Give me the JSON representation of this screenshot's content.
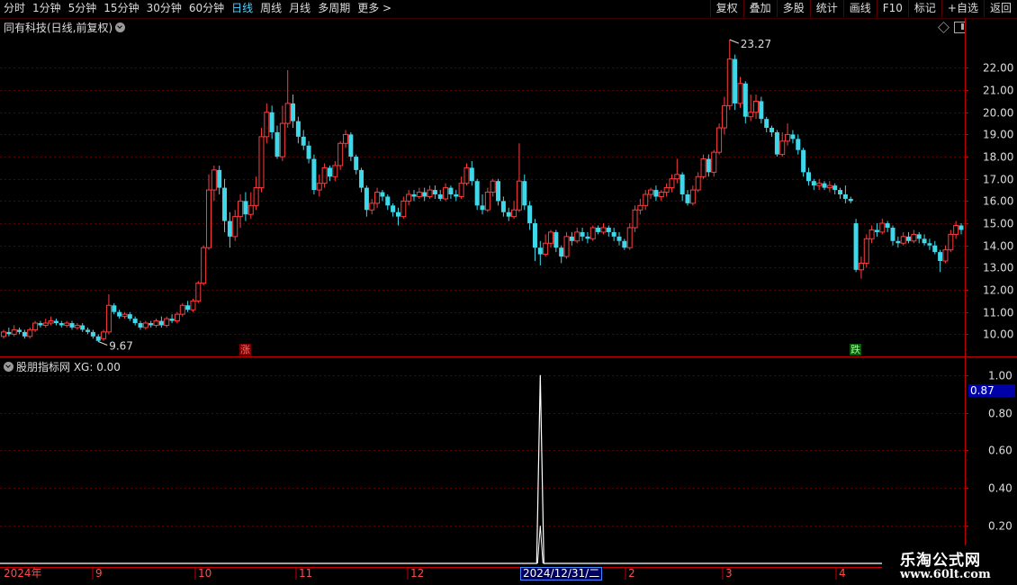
{
  "toolbar": {
    "left_items": [
      "分时",
      "1分钟",
      "5分钟",
      "15分钟",
      "30分钟",
      "60分钟",
      "日线",
      "周线",
      "月线",
      "多周期",
      "更多 >"
    ],
    "active": "日线",
    "right_buttons": [
      "复权",
      "叠加",
      "多股",
      "统计",
      "画线",
      "F10",
      "标记",
      "+自选",
      "返回"
    ]
  },
  "main_title": "同有科技(日线,前复权)",
  "indicator_title": "股朋指标网 XG: 0.00",
  "markers": {
    "rise": "涨",
    "fall": "跌"
  },
  "price_annotations": {
    "high": "23.27",
    "low": "9.67"
  },
  "date_labels": [
    "2024年",
    "9",
    "10",
    "11",
    "12",
    "2",
    "3",
    "4"
  ],
  "date_highlight": "2024/12/31/二",
  "indicator_current": "0.87",
  "watermark": {
    "line1": "乐淘公式网",
    "line2": "www.60lt.com"
  },
  "colors": {
    "up": "#ff3c3c",
    "down": "#3fd8ea",
    "background": "#000000",
    "grid": "#5a0000",
    "axis": "#c00000"
  },
  "chart_data": [
    {
      "type": "candlestick",
      "title": "同有科技(日线,前复权)",
      "y_ticks": [
        "10.00",
        "11.00",
        "12.00",
        "13.00",
        "14.00",
        "15.00",
        "16.00",
        "17.00",
        "18.00",
        "19.00",
        "20.00",
        "21.00",
        "22.00"
      ],
      "ylim": [
        9.0,
        23.6
      ],
      "high": 23.27,
      "low": 9.67,
      "candles": [
        [
          9.9,
          10.1,
          9.8,
          10.2
        ],
        [
          10.1,
          10.0,
          9.9,
          10.3
        ],
        [
          10.0,
          10.2,
          9.9,
          10.4
        ],
        [
          10.2,
          10.1,
          10.0,
          10.3
        ],
        [
          10.1,
          9.9,
          9.8,
          10.2
        ],
        [
          9.9,
          10.2,
          9.8,
          10.3
        ],
        [
          10.2,
          10.5,
          10.1,
          10.6
        ],
        [
          10.5,
          10.4,
          10.3,
          10.6
        ],
        [
          10.4,
          10.5,
          10.3,
          10.7
        ],
        [
          10.5,
          10.6,
          10.4,
          10.8
        ],
        [
          10.6,
          10.5,
          10.4,
          10.7
        ],
        [
          10.5,
          10.4,
          10.3,
          10.6
        ],
        [
          10.4,
          10.5,
          10.3,
          10.6
        ],
        [
          10.5,
          10.3,
          10.2,
          10.6
        ],
        [
          10.3,
          10.4,
          10.2,
          10.5
        ],
        [
          10.4,
          10.2,
          10.1,
          10.5
        ],
        [
          10.2,
          10.1,
          10.0,
          10.3
        ],
        [
          10.1,
          9.9,
          9.8,
          10.2
        ],
        [
          9.9,
          9.7,
          9.67,
          10.0
        ],
        [
          9.8,
          10.1,
          9.7,
          10.2
        ],
        [
          10.1,
          11.3,
          10.0,
          11.8
        ],
        [
          11.3,
          11.0,
          10.9,
          11.4
        ],
        [
          11.0,
          10.8,
          10.7,
          11.1
        ],
        [
          10.8,
          10.9,
          10.7,
          11.0
        ],
        [
          10.9,
          10.7,
          10.6,
          11.0
        ],
        [
          10.7,
          10.5,
          10.4,
          10.8
        ],
        [
          10.5,
          10.3,
          10.2,
          10.6
        ],
        [
          10.3,
          10.5,
          10.2,
          10.6
        ],
        [
          10.5,
          10.4,
          10.3,
          10.6
        ],
        [
          10.4,
          10.6,
          10.3,
          10.7
        ],
        [
          10.6,
          10.4,
          10.3,
          10.8
        ],
        [
          10.4,
          10.7,
          10.3,
          10.8
        ],
        [
          10.7,
          10.6,
          10.5,
          10.9
        ],
        [
          10.6,
          10.9,
          10.5,
          11.0
        ],
        [
          10.9,
          11.3,
          10.8,
          11.4
        ],
        [
          11.3,
          11.1,
          11.0,
          11.5
        ],
        [
          11.1,
          11.5,
          11.0,
          11.6
        ],
        [
          11.5,
          12.3,
          11.4,
          12.4
        ],
        [
          12.3,
          13.9,
          12.2,
          14.0
        ],
        [
          13.9,
          16.5,
          13.8,
          17.2
        ],
        [
          16.5,
          17.4,
          16.0,
          17.6
        ],
        [
          17.4,
          16.6,
          16.3,
          17.6
        ],
        [
          16.6,
          15.1,
          14.6,
          17.0
        ],
        [
          15.1,
          14.4,
          13.9,
          15.5
        ],
        [
          14.4,
          15.3,
          14.2,
          15.6
        ],
        [
          15.3,
          16.0,
          14.8,
          16.3
        ],
        [
          16.0,
          15.4,
          15.1,
          16.4
        ],
        [
          15.4,
          15.8,
          15.2,
          16.4
        ],
        [
          15.8,
          16.6,
          15.6,
          17.1
        ],
        [
          16.6,
          18.9,
          16.4,
          19.3
        ],
        [
          18.9,
          20.0,
          18.6,
          20.4
        ],
        [
          20.0,
          19.1,
          18.8,
          20.3
        ],
        [
          19.1,
          18.0,
          17.9,
          19.4
        ],
        [
          18.0,
          19.5,
          17.8,
          20.3
        ],
        [
          19.5,
          20.4,
          19.3,
          21.9
        ],
        [
          20.4,
          19.6,
          19.3,
          20.8
        ],
        [
          19.6,
          18.9,
          18.6,
          19.8
        ],
        [
          18.9,
          18.5,
          18.3,
          19.2
        ],
        [
          18.5,
          17.9,
          17.7,
          18.7
        ],
        [
          17.9,
          16.5,
          16.3,
          18.1
        ],
        [
          16.5,
          16.8,
          16.2,
          17.2
        ],
        [
          16.8,
          17.5,
          16.6,
          17.7
        ],
        [
          17.5,
          17.1,
          16.9,
          17.6
        ],
        [
          17.1,
          17.6,
          16.9,
          17.8
        ],
        [
          17.6,
          18.6,
          17.4,
          18.7
        ],
        [
          18.6,
          19.0,
          18.4,
          19.2
        ],
        [
          19.0,
          18.0,
          17.8,
          19.1
        ],
        [
          18.0,
          17.4,
          17.2,
          18.1
        ],
        [
          17.4,
          16.6,
          16.4,
          17.5
        ],
        [
          16.6,
          15.6,
          15.3,
          16.7
        ],
        [
          15.6,
          15.9,
          15.4,
          16.1
        ],
        [
          15.9,
          16.4,
          15.7,
          16.6
        ],
        [
          16.4,
          16.2,
          16.0,
          16.5
        ],
        [
          16.2,
          15.8,
          15.6,
          16.3
        ],
        [
          15.8,
          15.5,
          15.3,
          15.9
        ],
        [
          15.5,
          15.3,
          14.9,
          15.7
        ],
        [
          15.3,
          16.0,
          15.2,
          16.2
        ],
        [
          16.0,
          16.3,
          15.8,
          16.5
        ],
        [
          16.3,
          16.2,
          16.0,
          16.5
        ],
        [
          16.2,
          16.4,
          16.1,
          16.6
        ],
        [
          16.4,
          16.2,
          16.0,
          16.6
        ],
        [
          16.2,
          16.5,
          16.1,
          16.7
        ],
        [
          16.5,
          16.3,
          16.1,
          16.7
        ],
        [
          16.3,
          16.1,
          16.0,
          16.5
        ],
        [
          16.1,
          16.6,
          16.0,
          16.8
        ],
        [
          16.6,
          16.3,
          16.1,
          16.7
        ],
        [
          16.3,
          16.2,
          16.0,
          16.5
        ],
        [
          16.2,
          16.8,
          16.1,
          17.1
        ],
        [
          16.8,
          17.5,
          16.7,
          17.7
        ],
        [
          17.5,
          16.9,
          16.7,
          17.8
        ],
        [
          16.9,
          15.8,
          15.6,
          17.0
        ],
        [
          15.8,
          15.6,
          15.4,
          16.3
        ],
        [
          15.6,
          16.4,
          15.5,
          16.6
        ],
        [
          16.4,
          16.9,
          16.2,
          17.0
        ],
        [
          16.9,
          16.0,
          15.8,
          17.0
        ],
        [
          16.0,
          15.5,
          15.3,
          16.2
        ],
        [
          15.5,
          15.3,
          15.1,
          15.7
        ],
        [
          15.3,
          15.6,
          15.2,
          16.0
        ],
        [
          15.6,
          16.9,
          15.5,
          18.6
        ],
        [
          16.9,
          15.8,
          15.6,
          17.2
        ],
        [
          15.8,
          15.0,
          14.7,
          16.0
        ],
        [
          15.0,
          13.9,
          13.3,
          15.2
        ],
        [
          13.9,
          13.6,
          13.1,
          14.2
        ],
        [
          13.6,
          14.1,
          13.5,
          14.5
        ],
        [
          14.1,
          14.6,
          13.9,
          14.7
        ],
        [
          14.6,
          13.9,
          13.7,
          14.7
        ],
        [
          13.9,
          13.5,
          13.2,
          14.0
        ],
        [
          13.5,
          14.4,
          13.4,
          14.6
        ],
        [
          14.4,
          14.2,
          14.0,
          14.6
        ],
        [
          14.2,
          14.6,
          14.1,
          14.8
        ],
        [
          14.6,
          14.4,
          14.2,
          14.8
        ],
        [
          14.4,
          14.3,
          14.1,
          14.6
        ],
        [
          14.3,
          14.8,
          14.2,
          14.9
        ],
        [
          14.8,
          14.6,
          14.5,
          14.9
        ],
        [
          14.6,
          14.8,
          14.5,
          15.0
        ],
        [
          14.8,
          14.6,
          14.4,
          14.9
        ],
        [
          14.6,
          14.4,
          14.2,
          14.8
        ],
        [
          14.4,
          14.2,
          14.0,
          14.6
        ],
        [
          14.2,
          13.9,
          13.8,
          14.3
        ],
        [
          13.9,
          14.8,
          13.8,
          15.0
        ],
        [
          14.8,
          15.6,
          14.6,
          15.8
        ],
        [
          15.6,
          15.8,
          15.4,
          16.1
        ],
        [
          15.8,
          16.3,
          15.6,
          16.5
        ],
        [
          16.3,
          16.5,
          16.1,
          16.6
        ],
        [
          16.5,
          16.2,
          16.0,
          16.7
        ],
        [
          16.2,
          16.4,
          16.0,
          16.5
        ],
        [
          16.4,
          16.6,
          16.2,
          16.8
        ],
        [
          16.6,
          17.0,
          16.4,
          17.2
        ],
        [
          17.0,
          17.2,
          16.8,
          17.9
        ],
        [
          17.2,
          16.3,
          16.0,
          17.3
        ],
        [
          16.3,
          15.9,
          15.8,
          16.5
        ],
        [
          15.9,
          16.5,
          15.8,
          16.7
        ],
        [
          16.5,
          17.1,
          16.4,
          17.3
        ],
        [
          17.1,
          17.9,
          17.0,
          18.1
        ],
        [
          17.9,
          17.3,
          17.1,
          18.1
        ],
        [
          17.3,
          18.2,
          17.1,
          18.3
        ],
        [
          18.2,
          19.3,
          18.1,
          19.5
        ],
        [
          19.3,
          20.3,
          19.0,
          20.7
        ],
        [
          20.3,
          22.4,
          20.1,
          23.27
        ],
        [
          22.4,
          20.4,
          20.1,
          22.6
        ],
        [
          20.4,
          21.3,
          20.2,
          21.6
        ],
        [
          21.3,
          19.8,
          19.5,
          21.4
        ],
        [
          19.8,
          20.0,
          19.6,
          20.8
        ],
        [
          20.0,
          20.5,
          19.7,
          20.8
        ],
        [
          20.5,
          19.7,
          19.5,
          20.7
        ],
        [
          19.7,
          19.3,
          19.1,
          19.8
        ],
        [
          19.3,
          19.1,
          18.9,
          19.4
        ],
        [
          19.1,
          18.1,
          18.0,
          19.2
        ],
        [
          18.1,
          18.7,
          18.0,
          19.1
        ],
        [
          18.7,
          19.0,
          18.5,
          19.5
        ],
        [
          19.0,
          18.8,
          18.6,
          19.2
        ],
        [
          18.8,
          18.3,
          18.1,
          19.0
        ],
        [
          18.3,
          17.3,
          17.1,
          18.4
        ],
        [
          17.3,
          16.9,
          16.7,
          17.5
        ],
        [
          16.9,
          16.7,
          16.5,
          17.0
        ],
        [
          16.7,
          16.8,
          16.5,
          17.0
        ],
        [
          16.8,
          16.6,
          16.5,
          16.9
        ],
        [
          16.6,
          16.7,
          16.4,
          16.9
        ],
        [
          16.7,
          16.5,
          16.3,
          16.8
        ],
        [
          16.5,
          16.3,
          16.1,
          16.6
        ],
        [
          16.3,
          16.1,
          15.9,
          16.7
        ],
        [
          16.1,
          16.0,
          15.9,
          16.2
        ],
        [
          15.0,
          12.9,
          12.8,
          15.2
        ],
        [
          12.9,
          13.2,
          12.5,
          13.5
        ],
        [
          13.2,
          14.3,
          13.0,
          14.5
        ],
        [
          14.3,
          14.7,
          14.1,
          14.9
        ],
        [
          14.7,
          14.6,
          14.4,
          15.0
        ],
        [
          14.6,
          15.0,
          14.5,
          15.2
        ],
        [
          15.0,
          14.8,
          14.6,
          15.1
        ],
        [
          14.8,
          14.2,
          14.0,
          14.9
        ],
        [
          14.2,
          14.1,
          13.9,
          14.4
        ],
        [
          14.1,
          14.4,
          14.0,
          14.6
        ],
        [
          14.4,
          14.2,
          14.1,
          14.6
        ],
        [
          14.2,
          14.5,
          14.1,
          14.7
        ],
        [
          14.5,
          14.3,
          14.1,
          14.6
        ],
        [
          14.3,
          14.1,
          14.0,
          14.5
        ],
        [
          14.1,
          14.0,
          13.8,
          14.3
        ],
        [
          14.0,
          13.7,
          13.6,
          14.2
        ],
        [
          13.7,
          13.3,
          12.8,
          13.8
        ],
        [
          13.3,
          13.8,
          13.2,
          14.0
        ],
        [
          13.8,
          14.5,
          13.7,
          14.7
        ],
        [
          14.5,
          14.9,
          14.3,
          15.1
        ],
        [
          14.9,
          14.7,
          14.5,
          15.0
        ]
      ]
    },
    {
      "type": "line",
      "title": "股朋指标网 XG: 0.00",
      "y_ticks": [
        "0.20",
        "0.40",
        "0.60",
        "0.80",
        "1.00"
      ],
      "ylim": [
        0.0,
        1.08
      ],
      "x_pulse_index": 102,
      "value_at_pulse": 1.0
    }
  ]
}
